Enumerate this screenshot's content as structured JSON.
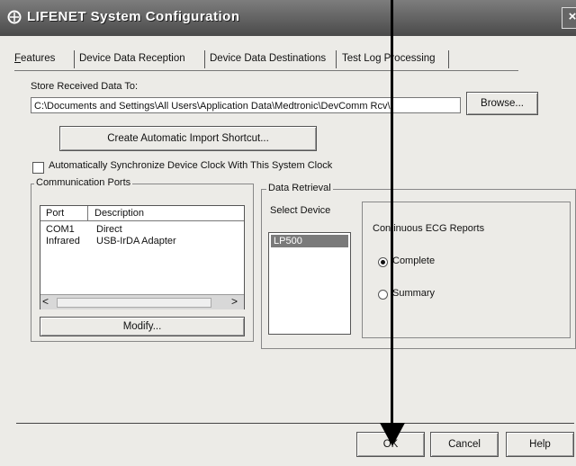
{
  "window": {
    "title": "LIFENET System Configuration",
    "close_symbol": "×"
  },
  "tabs": [
    {
      "label": "Features",
      "active": false
    },
    {
      "label": "Device Data Reception",
      "active": true
    },
    {
      "label": "Device Data Destinations",
      "active": false
    },
    {
      "label": "Test Log Processing",
      "active": false
    }
  ],
  "store": {
    "label": "Store Received Data To:",
    "path_value": "C:\\Documents and Settings\\All Users\\Application Data\\Medtronic\\DevComm Rcv\\",
    "browse_label": "Browse..."
  },
  "shortcut_button": "Create Automatic Import Shortcut...",
  "sync_checkbox": {
    "label": "Automatically Synchronize Device Clock With This System Clock",
    "checked": false
  },
  "comm_ports": {
    "legend": "Communication Ports",
    "columns": [
      "Port",
      "Description"
    ],
    "rows": [
      [
        "COM1",
        "Direct"
      ],
      [
        "Infrared",
        "USB-IrDA Adapter"
      ]
    ],
    "modify_label": "Modify..."
  },
  "data_retrieval": {
    "legend": "Data Retrieval",
    "select_device_label": "Select Device",
    "devices": [
      "LP500"
    ],
    "selected_device": "LP500",
    "reports_label": "Continuous ECG Reports",
    "options": [
      {
        "label": "Complete",
        "checked": true
      },
      {
        "label": "Summary",
        "checked": false
      }
    ]
  },
  "footer": {
    "ok_label": "OK",
    "cancel_label": "Cancel",
    "help_label": "Help"
  }
}
